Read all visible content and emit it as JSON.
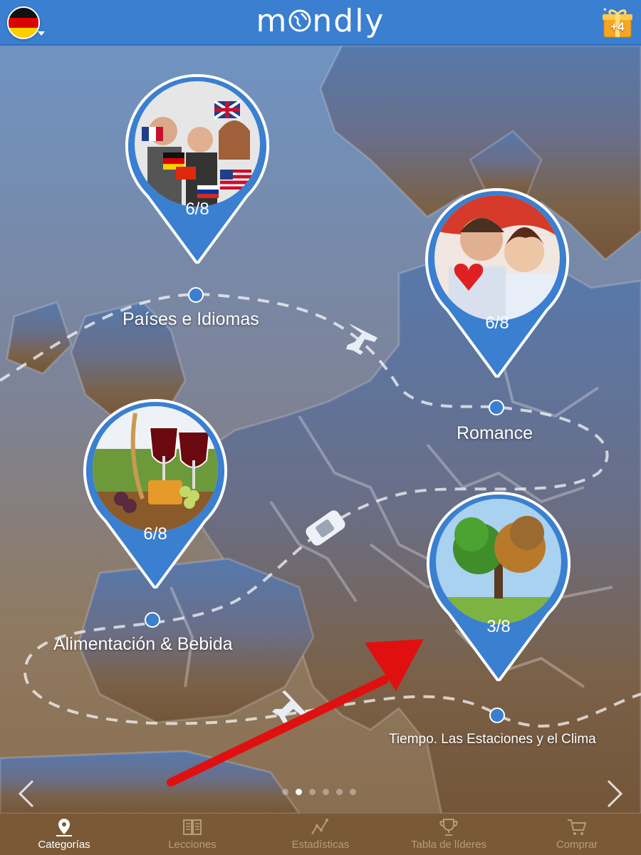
{
  "app": {
    "name": "mondly"
  },
  "header": {
    "language_flag": "germany-flag",
    "gift_badge": "+4"
  },
  "categories": [
    {
      "label": "Países e Idiomas",
      "progress": "6/8",
      "image": "group-with-flags-photo"
    },
    {
      "label": "Romance",
      "progress": "6/8",
      "image": "couple-photo"
    },
    {
      "label": "Alimentación & Bebida",
      "progress": "6/8",
      "image": "wine-and-food-photo"
    },
    {
      "label": "Tiempo. Las Estaciones y el Clima",
      "progress": "3/8",
      "image": "tree-seasons-photo"
    }
  ],
  "pager": {
    "pages": 6,
    "current": 2
  },
  "tabs": [
    {
      "label": "Categorías",
      "icon": "map-pin-icon",
      "active": true
    },
    {
      "label": "Lecciones",
      "icon": "book-icon",
      "active": false
    },
    {
      "label": "Estadísticas",
      "icon": "stats-icon",
      "active": false
    },
    {
      "label": "Tabla de líderes",
      "icon": "trophy-icon",
      "active": false
    },
    {
      "label": "Comprar",
      "icon": "cart-icon",
      "active": false
    }
  ],
  "colors": {
    "brand_blue": "#3a7fd0",
    "tabbar": "#7a5a36",
    "annotation_arrow": "#e01010"
  }
}
